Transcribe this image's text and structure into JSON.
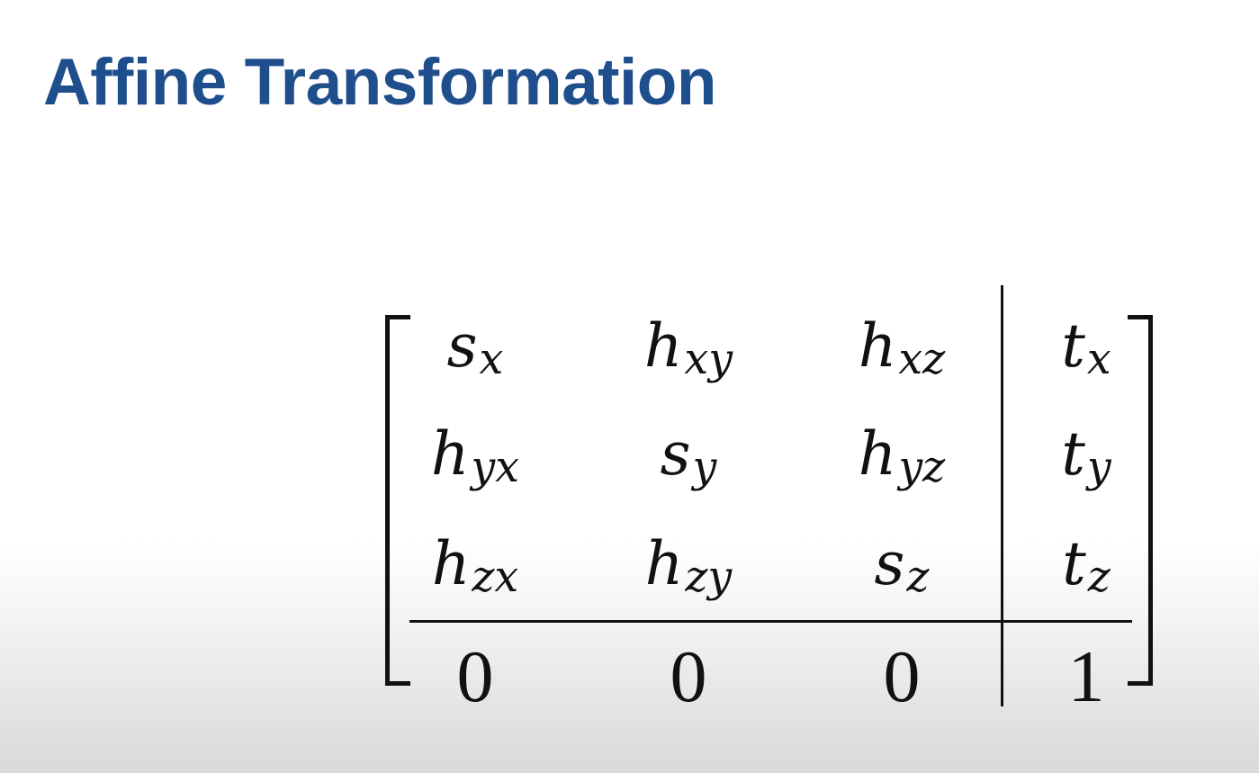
{
  "title": "Affine Transformation",
  "matrix": {
    "rows": [
      [
        {
          "base": "s",
          "sub": "x"
        },
        {
          "base": "h",
          "sub": "xy"
        },
        {
          "base": "h",
          "sub": "xz"
        },
        {
          "base": "t",
          "sub": "x"
        }
      ],
      [
        {
          "base": "h",
          "sub": "yx"
        },
        {
          "base": "s",
          "sub": "y"
        },
        {
          "base": "h",
          "sub": "yz"
        },
        {
          "base": "t",
          "sub": "y"
        }
      ],
      [
        {
          "base": "h",
          "sub": "zx"
        },
        {
          "base": "h",
          "sub": "zy"
        },
        {
          "base": "s",
          "sub": "z"
        },
        {
          "base": "t",
          "sub": "z"
        }
      ],
      [
        {
          "base": "0",
          "sub": ""
        },
        {
          "base": "0",
          "sub": ""
        },
        {
          "base": "0",
          "sub": ""
        },
        {
          "base": "1",
          "sub": ""
        }
      ]
    ]
  }
}
